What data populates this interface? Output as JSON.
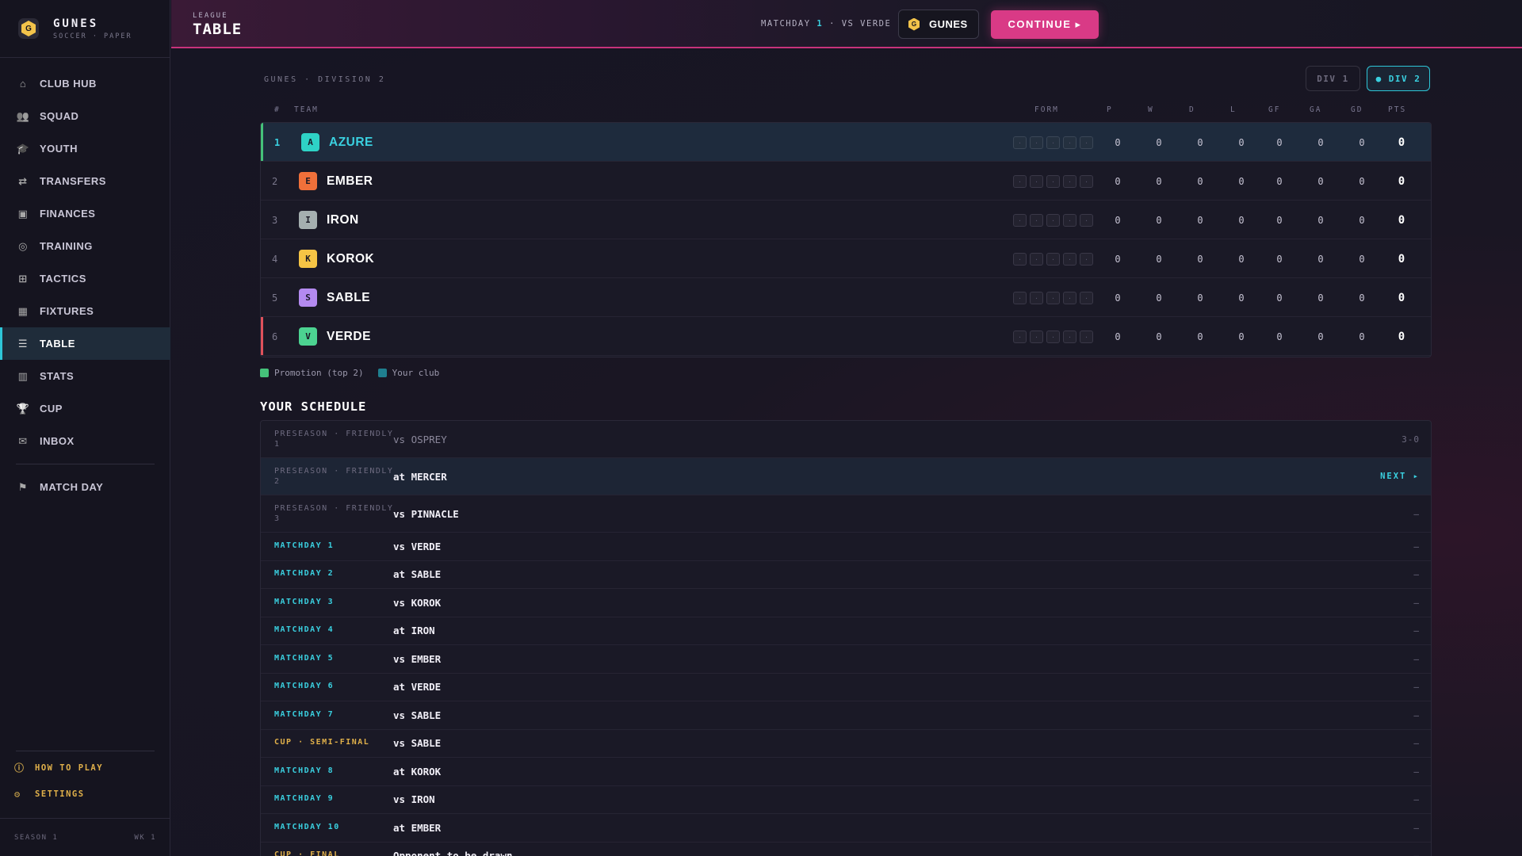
{
  "brand": {
    "name": "GUNES",
    "sub": "SOCCER · PAPER",
    "logo_letter": "G"
  },
  "nav": [
    {
      "label": "CLUB HUB",
      "icon": "home-icon",
      "glyph": "⌂"
    },
    {
      "label": "SQUAD",
      "icon": "squad-icon",
      "glyph": "👥"
    },
    {
      "label": "YOUTH",
      "icon": "graduation-icon",
      "glyph": "🎓"
    },
    {
      "label": "TRANSFERS",
      "icon": "transfer-arrows-icon",
      "glyph": "⇄"
    },
    {
      "label": "FINANCES",
      "icon": "wallet-icon",
      "glyph": "▣"
    },
    {
      "label": "TRAINING",
      "icon": "target-icon",
      "glyph": "◎"
    },
    {
      "label": "TACTICS",
      "icon": "grid-icon",
      "glyph": "⊞"
    },
    {
      "label": "FIXTURES",
      "icon": "calendar-icon",
      "glyph": "▦"
    },
    {
      "label": "TABLE",
      "icon": "list-icon",
      "glyph": "☰",
      "active": true
    },
    {
      "label": "STATS",
      "icon": "bar-chart-icon",
      "glyph": "▥"
    },
    {
      "label": "CUP",
      "icon": "trophy-icon",
      "glyph": "🏆"
    },
    {
      "label": "INBOX",
      "icon": "mail-icon",
      "glyph": "✉"
    }
  ],
  "nav_extra": {
    "label": "MATCH DAY",
    "icon": "flag-icon",
    "glyph": "⚑"
  },
  "utility": {
    "help": "HOW TO PLAY",
    "settings": "SETTINGS"
  },
  "season": {
    "season": "SEASON 1",
    "week": "WK 1"
  },
  "header": {
    "overline": "LEAGUE",
    "title": "TABLE",
    "match_prefix": "MATCHDAY",
    "match_num": "1",
    "match_suffix": "· VS VERDE",
    "club": "GUNES",
    "continue": "CONTINUE ▸"
  },
  "breadcrumb": "GUNES · DIVISION 2",
  "divisions": {
    "div1": "DIV 1",
    "div2": "● DIV 2"
  },
  "table_headers": {
    "rank": "#",
    "team": "TEAM",
    "form": "FORM",
    "p": "P",
    "w": "W",
    "d": "D",
    "l": "L",
    "gf": "GF",
    "ga": "GA",
    "gd": "GD",
    "pts": "PTS"
  },
  "standings": [
    {
      "rank": "1",
      "letter": "A",
      "team": "AZURE",
      "color": "#2ed3c6",
      "zone": "promotion",
      "own": true,
      "form": [
        "·",
        "·",
        "·",
        "·",
        "·"
      ],
      "p": "0",
      "w": "0",
      "d": "0",
      "l": "0",
      "gf": "0",
      "ga": "0",
      "gd": "0",
      "pts": "0"
    },
    {
      "rank": "2",
      "letter": "E",
      "team": "EMBER",
      "color": "#f0703a",
      "zone": "none",
      "own": false,
      "form": [
        "·",
        "·",
        "·",
        "·",
        "·"
      ],
      "p": "0",
      "w": "0",
      "d": "0",
      "l": "0",
      "gf": "0",
      "ga": "0",
      "gd": "0",
      "pts": "0"
    },
    {
      "rank": "3",
      "letter": "I",
      "team": "IRON",
      "color": "#a5afb0",
      "zone": "none",
      "own": false,
      "form": [
        "·",
        "·",
        "·",
        "·",
        "·"
      ],
      "p": "0",
      "w": "0",
      "d": "0",
      "l": "0",
      "gf": "0",
      "ga": "0",
      "gd": "0",
      "pts": "0"
    },
    {
      "rank": "4",
      "letter": "K",
      "team": "KOROK",
      "color": "#f5c445",
      "zone": "none",
      "own": false,
      "form": [
        "·",
        "·",
        "·",
        "·",
        "·"
      ],
      "p": "0",
      "w": "0",
      "d": "0",
      "l": "0",
      "gf": "0",
      "ga": "0",
      "gd": "0",
      "pts": "0"
    },
    {
      "rank": "5",
      "letter": "S",
      "team": "SABLE",
      "color": "#b48af0",
      "zone": "none",
      "own": false,
      "form": [
        "·",
        "·",
        "·",
        "·",
        "·"
      ],
      "p": "0",
      "w": "0",
      "d": "0",
      "l": "0",
      "gf": "0",
      "ga": "0",
      "gd": "0",
      "pts": "0"
    },
    {
      "rank": "6",
      "letter": "V",
      "team": "VERDE",
      "color": "#4cd391",
      "zone": "relegation",
      "own": false,
      "form": [
        "·",
        "·",
        "·",
        "·",
        "·"
      ],
      "p": "0",
      "w": "0",
      "d": "0",
      "l": "0",
      "gf": "0",
      "ga": "0",
      "gd": "0",
      "pts": "0"
    }
  ],
  "legend": {
    "promotion": "Promotion (top 2)",
    "your_club": "Your club"
  },
  "colors": {
    "accent": "#2ec6d8",
    "cta": "#d93a86",
    "promotion": "#45c27a",
    "relegation": "#e0515b",
    "cup": "#e0b04a"
  },
  "schedule_title": "YOUR SCHEDULE",
  "schedule": [
    {
      "label": "PRESEASON · FRIENDLY 1",
      "kind": "pre",
      "opp": "vs OSPREY",
      "result": "3-0",
      "played": true
    },
    {
      "label": "PRESEASON · FRIENDLY 2",
      "kind": "pre",
      "opp": "at MERCER",
      "result": "NEXT ▸",
      "next": true
    },
    {
      "label": "PRESEASON · FRIENDLY 3",
      "kind": "pre",
      "opp": "vs PINNACLE",
      "result": "—"
    },
    {
      "label": "MATCHDAY 1",
      "kind": "md",
      "opp": "vs VERDE",
      "result": "—"
    },
    {
      "label": "MATCHDAY 2",
      "kind": "md",
      "opp": "at SABLE",
      "result": "—"
    },
    {
      "label": "MATCHDAY 3",
      "kind": "md",
      "opp": "vs KOROK",
      "result": "—"
    },
    {
      "label": "MATCHDAY 4",
      "kind": "md",
      "opp": "at IRON",
      "result": "—"
    },
    {
      "label": "MATCHDAY 5",
      "kind": "md",
      "opp": "vs EMBER",
      "result": "—"
    },
    {
      "label": "MATCHDAY 6",
      "kind": "md",
      "opp": "at VERDE",
      "result": "—"
    },
    {
      "label": "MATCHDAY 7",
      "kind": "md",
      "opp": "vs SABLE",
      "result": "—"
    },
    {
      "label": "CUP · SEMI-FINAL",
      "kind": "cup",
      "opp": "vs SABLE",
      "result": "—"
    },
    {
      "label": "MATCHDAY 8",
      "kind": "md",
      "opp": "at KOROK",
      "result": "—"
    },
    {
      "label": "MATCHDAY 9",
      "kind": "md",
      "opp": "vs IRON",
      "result": "—"
    },
    {
      "label": "MATCHDAY 10",
      "kind": "md",
      "opp": "at EMBER",
      "result": "—"
    },
    {
      "label": "CUP · FINAL",
      "kind": "cup",
      "opp": "Opponent to be drawn",
      "result": "—"
    }
  ]
}
